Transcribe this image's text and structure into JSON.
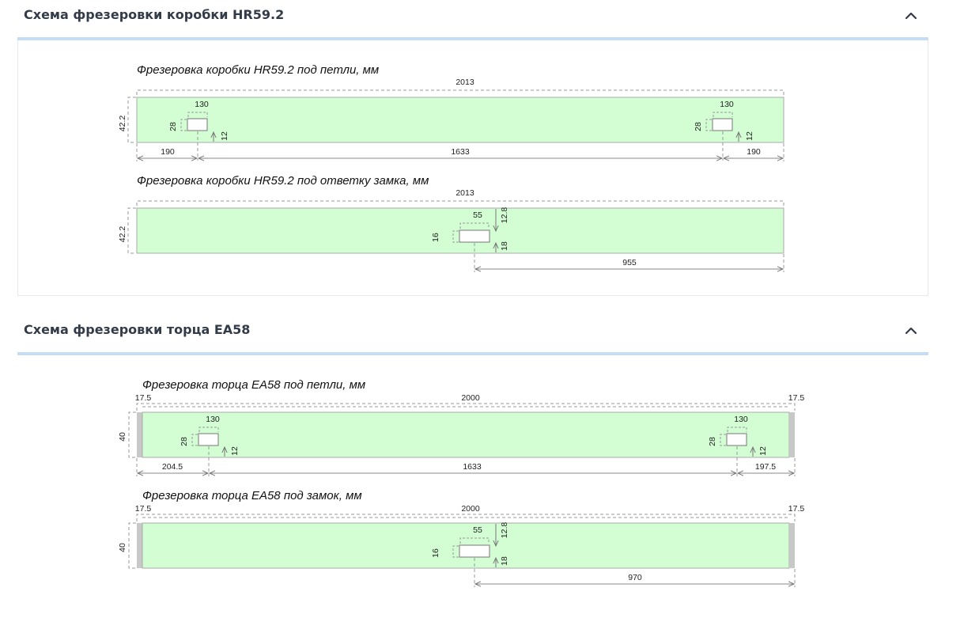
{
  "sections": [
    {
      "title": "Схема фрезеровки коробки HR59.2",
      "diagrams": [
        {
          "title": "Фрезеровка коробки HR59.2 под петли, мм",
          "length": "2013",
          "height": "42.2",
          "hinge_left": {
            "width": "130",
            "depth": "28",
            "offset": "12"
          },
          "hinge_right": {
            "width": "130",
            "depth": "28",
            "offset": "12"
          },
          "bottom_dims": [
            "190",
            "1633",
            "190"
          ]
        },
        {
          "title": "Фрезеровка коробки HR59.2 под ответку замка, мм",
          "length": "2013",
          "height": "42.2",
          "lock": {
            "width": "55",
            "depth": "16",
            "top": "12.8",
            "bottom": "18"
          },
          "bottom_dim": "955"
        }
      ]
    },
    {
      "title": "Схема фрезеровки торца EA58",
      "diagrams": [
        {
          "title": "Фрезеровка торца EA58 под петли, мм",
          "length": "2000",
          "height": "40",
          "end_left": "17.5",
          "end_right": "17.5",
          "hinge_left": {
            "width": "130",
            "depth": "28",
            "offset": "12"
          },
          "hinge_right": {
            "width": "130",
            "depth": "28",
            "offset": "12"
          },
          "bottom_dims": [
            "204.5",
            "1633",
            "197.5"
          ]
        },
        {
          "title": "Фрезеровка торца EA58 под замок, мм",
          "length": "2000",
          "height": "40",
          "end_left": "17.5",
          "end_right": "17.5",
          "lock": {
            "width": "55",
            "depth": "16",
            "top": "12.8",
            "bottom": "18"
          },
          "bottom_dim": "970"
        }
      ]
    }
  ],
  "colors": {
    "board": "#d3fdd3",
    "end_cap": "#c8c8c8",
    "line": "#9a9a9a",
    "header_bar": "#c5dcf6",
    "title": "#333b48"
  },
  "icons": {
    "collapse": "chevron-up-icon"
  }
}
